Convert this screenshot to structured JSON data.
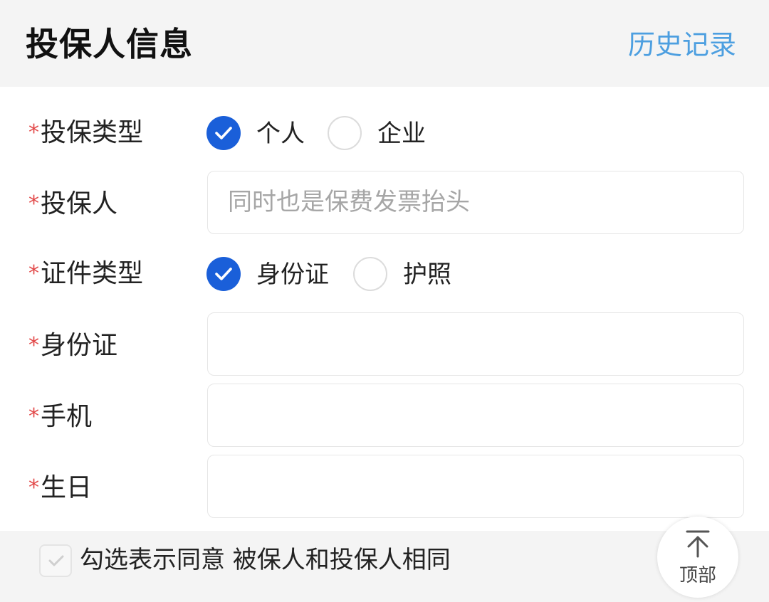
{
  "header": {
    "title": "投保人信息",
    "history_label": "历史记录"
  },
  "form": {
    "required_mark": "*",
    "policy_type": {
      "label": "投保类型",
      "options": [
        {
          "label": "个人",
          "checked": true
        },
        {
          "label": "企业",
          "checked": false
        }
      ]
    },
    "policyholder": {
      "label": "投保人",
      "placeholder": "同时也是保费发票抬头",
      "value": ""
    },
    "id_type": {
      "label": "证件类型",
      "options": [
        {
          "label": "身份证",
          "checked": true
        },
        {
          "label": "护照",
          "checked": false
        }
      ]
    },
    "id_number": {
      "label": "身份证",
      "value": ""
    },
    "phone": {
      "label": "手机",
      "value": ""
    },
    "birthday": {
      "label": "生日",
      "value": ""
    }
  },
  "footer": {
    "agree_text": "勾选表示同意 被保人和投保人相同",
    "agree_checked": false
  },
  "back_to_top": {
    "label": "顶部"
  },
  "colors": {
    "accent": "#1a5fd9",
    "link": "#4d9fe0",
    "required": "#e24a4a",
    "header_bg": "#f4f4f4"
  }
}
